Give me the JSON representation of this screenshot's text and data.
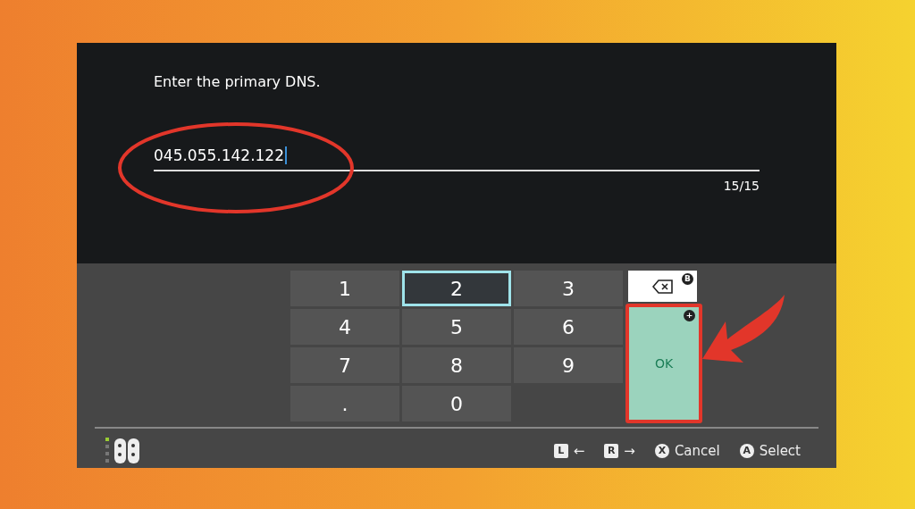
{
  "prompt": "Enter the primary DNS.",
  "field": {
    "value": "045.055.142.122",
    "counter": "15/15"
  },
  "keys": [
    {
      "label": "1",
      "selected": false
    },
    {
      "label": "2",
      "selected": true
    },
    {
      "label": "3",
      "selected": false
    },
    {
      "label": "4",
      "selected": false
    },
    {
      "label": "5",
      "selected": false
    },
    {
      "label": "6",
      "selected": false
    },
    {
      "label": "7",
      "selected": false
    },
    {
      "label": "8",
      "selected": false
    },
    {
      "label": "9",
      "selected": false
    },
    {
      "label": ".",
      "selected": false
    },
    {
      "label": "0",
      "selected": false
    }
  ],
  "backspace": {
    "badge": "B"
  },
  "ok": {
    "label": "OK",
    "badge": "+"
  },
  "footer": [
    {
      "button": "L",
      "label": "←",
      "kind": "shoulder"
    },
    {
      "button": "R",
      "label": "→",
      "kind": "shoulder"
    },
    {
      "button": "X",
      "label": "Cancel",
      "kind": "face"
    },
    {
      "button": "A",
      "label": "Select",
      "kind": "face"
    }
  ]
}
